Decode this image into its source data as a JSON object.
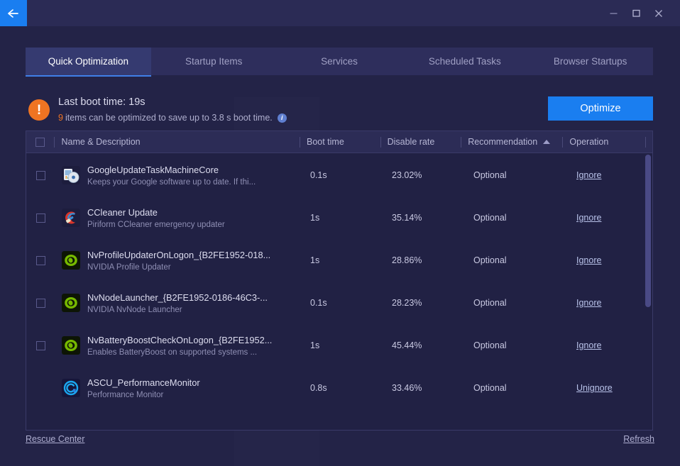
{
  "titlebar": {
    "back_icon": "arrow-left-icon",
    "minimize_label": "–",
    "maximize_label": "☐",
    "close_label": "✕"
  },
  "tabs": [
    {
      "label": "Quick Optimization",
      "active": true
    },
    {
      "label": "Startup Items",
      "active": false
    },
    {
      "label": "Services",
      "active": false
    },
    {
      "label": "Scheduled Tasks",
      "active": false
    },
    {
      "label": "Browser Startups",
      "active": false
    }
  ],
  "info": {
    "warn_glyph": "!",
    "boot_time_line": "Last boot time: 19s",
    "item_count": "9",
    "detail_text": "items can be optimized to save up to 3.8 s boot time.",
    "help_glyph": "i",
    "optimize_label": "Optimize"
  },
  "table": {
    "headers": {
      "name": "Name & Description",
      "boot_time": "Boot time",
      "disable_rate": "Disable rate",
      "recommendation": "Recommendation",
      "operation": "Operation"
    },
    "sort_column": "Recommendation",
    "sort_direction": "ascending",
    "rows": [
      {
        "name": "GoogleUpdateTaskMachineCore",
        "description": "Keeps your Google software up to date. If thi...",
        "boot_time": "0.1s",
        "disable_rate": "23.02%",
        "recommendation": "Optional",
        "operation": "Ignore",
        "checked": false,
        "icon": "google-update-icon"
      },
      {
        "name": "CCleaner Update",
        "description": "Piriform CCleaner emergency updater",
        "boot_time": "1s",
        "disable_rate": "35.14%",
        "recommendation": "Optional",
        "operation": "Ignore",
        "checked": false,
        "icon": "ccleaner-icon"
      },
      {
        "name": "NvProfileUpdaterOnLogon_{B2FE1952-018...",
        "description": "NVIDIA Profile Updater",
        "boot_time": "1s",
        "disable_rate": "28.86%",
        "recommendation": "Optional",
        "operation": "Ignore",
        "checked": false,
        "icon": "nvidia-icon"
      },
      {
        "name": "NvNodeLauncher_{B2FE1952-0186-46C3-...",
        "description": "NVIDIA NvNode Launcher",
        "boot_time": "0.1s",
        "disable_rate": "28.23%",
        "recommendation": "Optional",
        "operation": "Ignore",
        "checked": false,
        "icon": "nvidia-icon"
      },
      {
        "name": "NvBatteryBoostCheckOnLogon_{B2FE1952...",
        "description": "Enables BatteryBoost on supported systems ...",
        "boot_time": "1s",
        "disable_rate": "45.44%",
        "recommendation": "Optional",
        "operation": "Ignore",
        "checked": false,
        "icon": "nvidia-icon"
      },
      {
        "name": "ASCU_PerformanceMonitor",
        "description": "Performance Monitor",
        "boot_time": "0.8s",
        "disable_rate": "33.46%",
        "recommendation": "Optional",
        "operation": "Unignore",
        "checked": null,
        "icon": "ascu-icon"
      }
    ]
  },
  "footer": {
    "rescue_center": "Rescue Center",
    "refresh": "Refresh"
  },
  "colors": {
    "accent_blue": "#1a7ef0",
    "warning_orange": "#ef7422",
    "window_bg": "#232347",
    "table_bg": "#212144",
    "tab_active_bg": "#353a70"
  }
}
